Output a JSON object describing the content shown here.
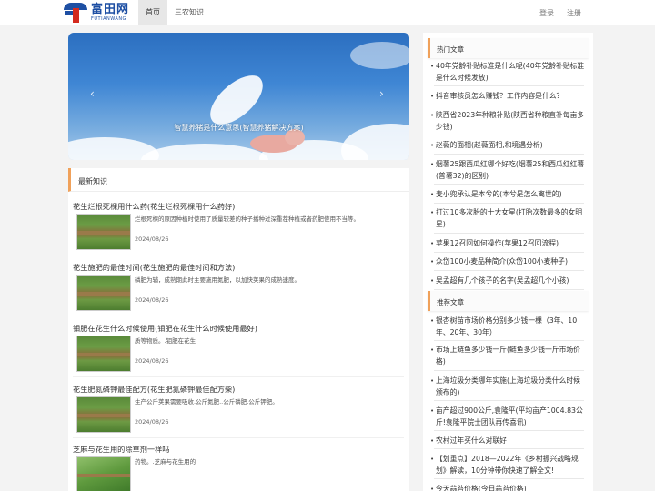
{
  "header": {
    "logo_cn": "富田网",
    "logo_en": "FUTIANWANG",
    "nav": [
      "首页",
      "三农知识"
    ],
    "login": "登录",
    "register": "注册"
  },
  "banner": {
    "caption": "智慧养猪是什么意思(智慧养猪解决方案)",
    "prev_glyph": "‹",
    "next_glyph": "›"
  },
  "latest": {
    "title": "最新知识",
    "articles": [
      {
        "title": "花生烂根死棵用什么药(花生烂根死棵用什么药好)",
        "desc": "烂根死棵的原因种植时使用了质量较差的种子播种过深重茬种植或者药肥使用不当等。",
        "date": "2024/08/26"
      },
      {
        "title": "花生施肥的最佳时间(花生施肥的最佳时间和方法)",
        "desc": "磷肥为辅，成熟期此时主要施用氮肥，以加快荚果的成熟速度。",
        "date": "2024/08/26"
      },
      {
        "title": "钼肥在花生什么时候使用(钼肥在花生什么时候使用最好)",
        "desc": "质等物质。.钼肥在花生",
        "date": "2024/08/26"
      },
      {
        "title": "花生肥氮磷钾最佳配方(花生肥氮磷钾最佳配方柴)",
        "desc": "生产公斤荚果需要吸收.公斤氮肥..公斤磷肥.公斤钾肥。",
        "date": "2024/08/26"
      },
      {
        "title": "芝麻与花生用的除草剂一样吗",
        "desc": "药物。.芝麻与花生用的",
        "date": ""
      }
    ]
  },
  "hot": {
    "title": "热门文章",
    "items": [
      "40年党龄补贴标准是什么呢(40年党龄补贴标准是什么时候发放)",
      "抖音审核员怎么赚钱？工作内容是什么？",
      "陕西省2023年种粮补贴(陕西省种粮直补每亩多少钱)",
      "赵薇的面相(赵薇面相,和境遇分析)",
      "烟薯25跟西瓜红哪个好吃(烟薯25和西瓜红红薯(普薯32)的区别)",
      "麦小兜承认是本兮的(本兮是怎么离世的)",
      "打过10多次胎的十大女星(打胎次数最多的女明星)",
      "苹果12召回如何操作(苹果12召回流程)",
      "众岱100小麦品种简介(众岱100小麦种子)",
      "吴孟超有几个孩子的名字(吴孟超几个小孩)"
    ]
  },
  "recommend": {
    "title": "推荐文章",
    "items": [
      "银杏树苗市场价格分别多少钱一棵（3年、10年、20年、30年）",
      "市场上鲢鱼多少钱一斤(鲢鱼多少钱一斤市场价格)",
      "上海垃圾分类哪年实施(上海垃圾分类什么时候颁布的)",
      "亩产超过900公斤,袁隆平(平均亩产1004.83公斤!袁隆平院士团队再传喜讯)",
      "农村过年买什么对联好",
      "【划重点】2018—2022年《乡村振兴战略规划》解读，10分钟带你快速了解全文!",
      "今天蒜苔价格(今日蒜苔价格)"
    ]
  }
}
